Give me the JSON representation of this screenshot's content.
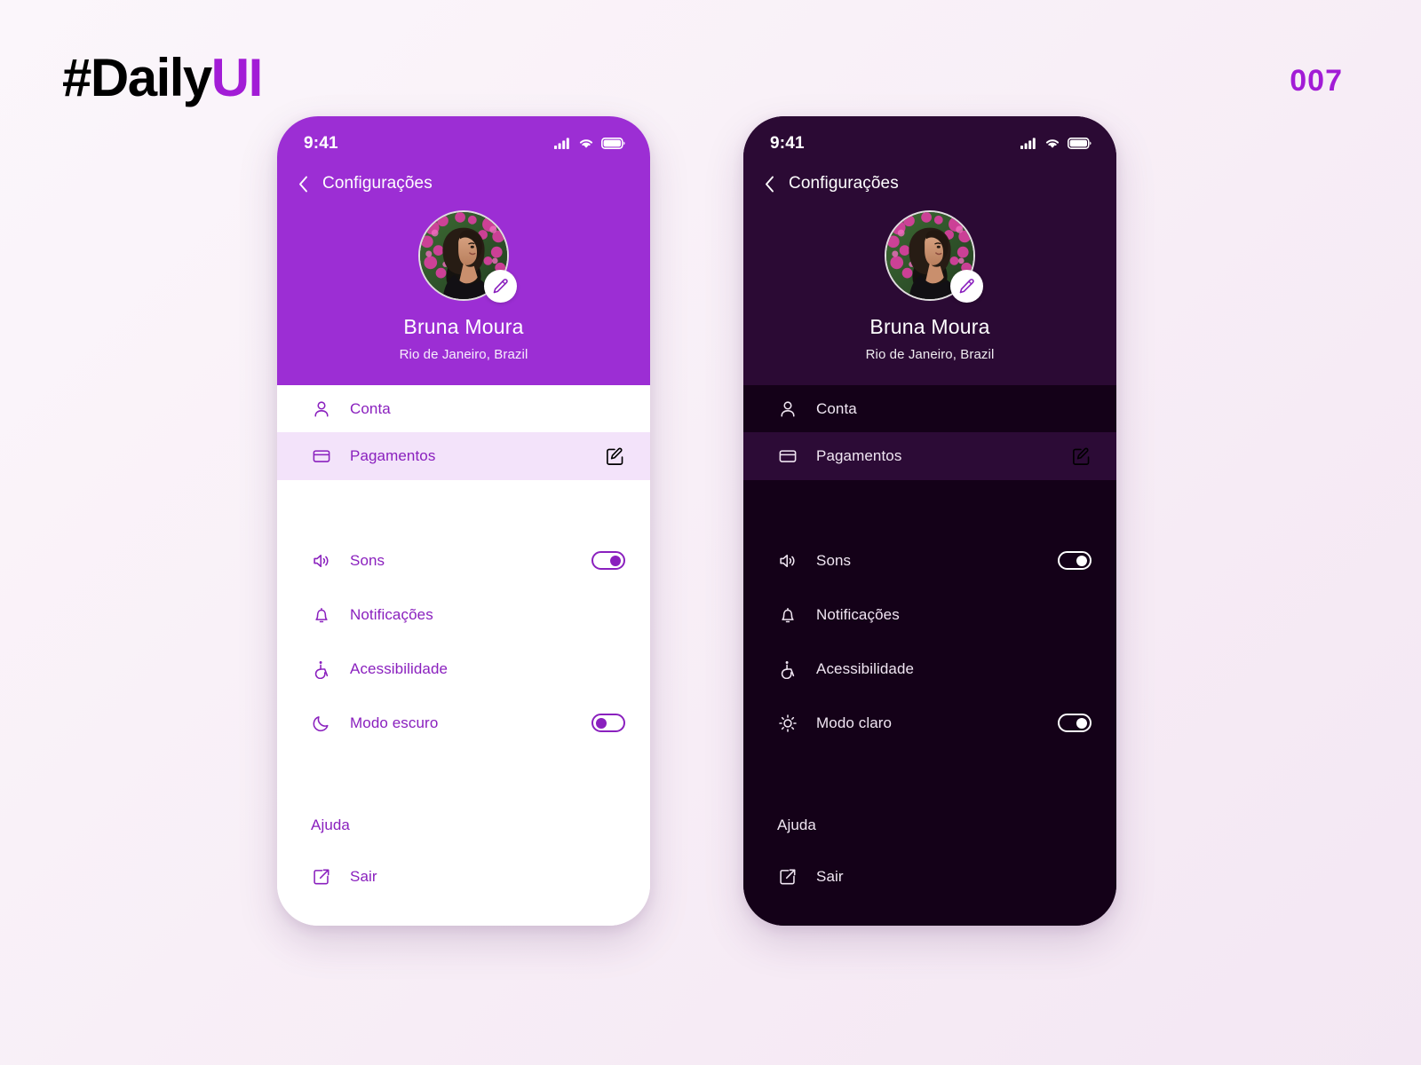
{
  "brand": {
    "hash_text": "#Daily",
    "ui_text": "UI",
    "day_number": "007",
    "accent_color": "#A21CD6"
  },
  "phones": [
    {
      "theme": "light",
      "status_bar": {
        "time": "9:41",
        "icons": [
          "signal-icon",
          "wifi-icon",
          "battery-icon"
        ]
      },
      "nav": {
        "back_icon": "chevron-left-icon",
        "title": "Configurações"
      },
      "profile": {
        "name": "Bruna Moura",
        "location": "Rio de Janeiro, Brazil",
        "avatar_alt": "user-avatar",
        "edit_icon": "pencil-icon"
      },
      "menu": [
        {
          "key": "account",
          "label": "Conta",
          "icon": "person-icon",
          "highlighted": false,
          "action_icon": null
        },
        {
          "key": "payments",
          "label": "Pagamentos",
          "icon": "credit-card-icon",
          "highlighted": true,
          "action_icon": "edit-square-icon"
        }
      ],
      "settings": [
        {
          "key": "sounds",
          "label": "Sons",
          "icon": "speaker-icon",
          "toggle": "on"
        },
        {
          "key": "notifications",
          "label": "Notificações",
          "icon": "bell-icon",
          "toggle": null
        },
        {
          "key": "accessibility",
          "label": "Acessibilidade",
          "icon": "accessibility-icon",
          "toggle": null
        },
        {
          "key": "theme",
          "label": "Modo escuro",
          "icon": "moon-icon",
          "toggle": "off"
        }
      ],
      "footer": [
        {
          "key": "help",
          "label": "Ajuda",
          "icon": null
        },
        {
          "key": "logout",
          "label": "Sair",
          "icon": "logout-icon"
        }
      ],
      "colors": {
        "header_bg": "#9C2ED4",
        "body_bg": "#FFFFFF",
        "highlight_row_bg": "#F3E3FA",
        "text": "#8A20BE"
      }
    },
    {
      "theme": "dark",
      "status_bar": {
        "time": "9:41",
        "icons": [
          "signal-icon",
          "wifi-icon",
          "battery-icon"
        ]
      },
      "nav": {
        "back_icon": "chevron-left-icon",
        "title": "Configurações"
      },
      "profile": {
        "name": "Bruna Moura",
        "location": "Rio de Janeiro, Brazil",
        "avatar_alt": "user-avatar",
        "edit_icon": "pencil-icon"
      },
      "menu": [
        {
          "key": "account",
          "label": "Conta",
          "icon": "person-icon",
          "highlighted": false,
          "action_icon": null
        },
        {
          "key": "payments",
          "label": "Pagamentos",
          "icon": "credit-card-icon",
          "highlighted": true,
          "action_icon": "edit-square-icon"
        }
      ],
      "settings": [
        {
          "key": "sounds",
          "label": "Sons",
          "icon": "speaker-icon",
          "toggle": "on"
        },
        {
          "key": "notifications",
          "label": "Notificações",
          "icon": "bell-icon",
          "toggle": null
        },
        {
          "key": "accessibility",
          "label": "Acessibilidade",
          "icon": "accessibility-icon",
          "toggle": null
        },
        {
          "key": "theme",
          "label": "Modo claro",
          "icon": "sun-icon",
          "toggle": "on"
        }
      ],
      "footer": [
        {
          "key": "help",
          "label": "Ajuda",
          "icon": null
        },
        {
          "key": "logout",
          "label": "Sair",
          "icon": "logout-icon"
        }
      ],
      "colors": {
        "header_bg": "#2B0A34",
        "body_bg": "#140118",
        "highlight_row_bg": "#2C0B36",
        "text": "#F0E6F2"
      }
    }
  ]
}
